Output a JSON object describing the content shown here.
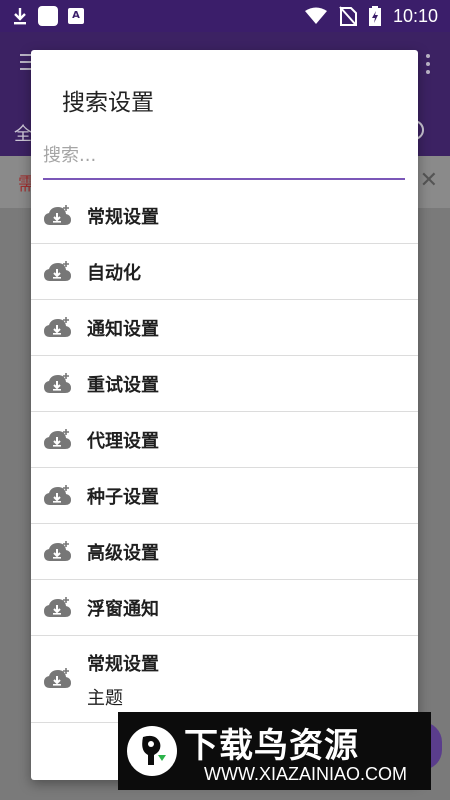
{
  "status_bar": {
    "time": "10:10",
    "icons": [
      "download-icon",
      "square-app-icon",
      "font-app-icon",
      "wifi-icon",
      "no-sim-icon",
      "battery-charging-icon"
    ]
  },
  "background_app": {
    "tab_peek": "全",
    "banner_peek": "需"
  },
  "dialog": {
    "title": "搜索设置",
    "search": {
      "placeholder": "搜索...",
      "value": ""
    },
    "items": [
      {
        "label": "常规设置",
        "icon": "cloud-download-icon"
      },
      {
        "label": "自动化",
        "icon": "cloud-download-icon"
      },
      {
        "label": "通知设置",
        "icon": "cloud-download-icon"
      },
      {
        "label": "重试设置",
        "icon": "cloud-download-icon"
      },
      {
        "label": "代理设置",
        "icon": "cloud-download-icon"
      },
      {
        "label": "种子设置",
        "icon": "cloud-download-icon"
      },
      {
        "label": "高级设置",
        "icon": "cloud-download-icon"
      },
      {
        "label": "浮窗通知",
        "icon": "cloud-download-icon"
      },
      {
        "label": "常规设置",
        "sublabel": "主题",
        "icon": "cloud-download-icon"
      }
    ]
  },
  "watermark": {
    "title": "下载鸟资源",
    "url": "WWW.XIAZAINIAO.COM"
  },
  "colors": {
    "primary": "#3c2263",
    "accent": "#7b57b8",
    "icon_gray": "#777777"
  }
}
